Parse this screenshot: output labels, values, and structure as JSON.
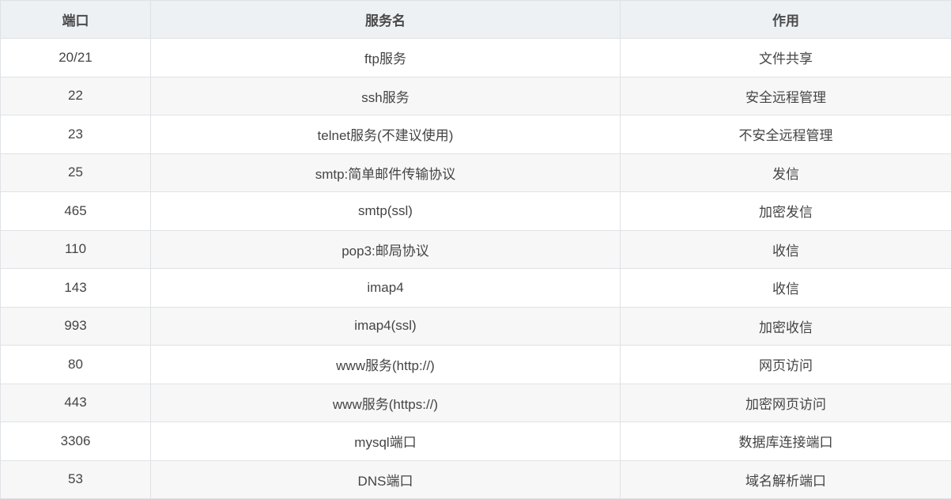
{
  "table": {
    "headers": [
      "端口",
      "服务名",
      "作用"
    ],
    "rows": [
      [
        "20/21",
        "ftp服务",
        "文件共享"
      ],
      [
        "22",
        "ssh服务",
        "安全远程管理"
      ],
      [
        "23",
        "telnet服务(不建议使用)",
        "不安全远程管理"
      ],
      [
        "25",
        "smtp:简单邮件传输协议",
        "发信"
      ],
      [
        "465",
        "smtp(ssl)",
        "加密发信"
      ],
      [
        "110",
        "pop3:邮局协议",
        "收信"
      ],
      [
        "143",
        "imap4",
        "收信"
      ],
      [
        "993",
        "imap4(ssl)",
        "加密收信"
      ],
      [
        "80",
        "www服务(http://)",
        "网页访问"
      ],
      [
        "443",
        "www服务(https://)",
        "加密网页访问"
      ],
      [
        "3306",
        "mysql端口",
        "数据库连接端口"
      ],
      [
        "53",
        "DNS端口",
        "域名解析端口"
      ]
    ]
  }
}
